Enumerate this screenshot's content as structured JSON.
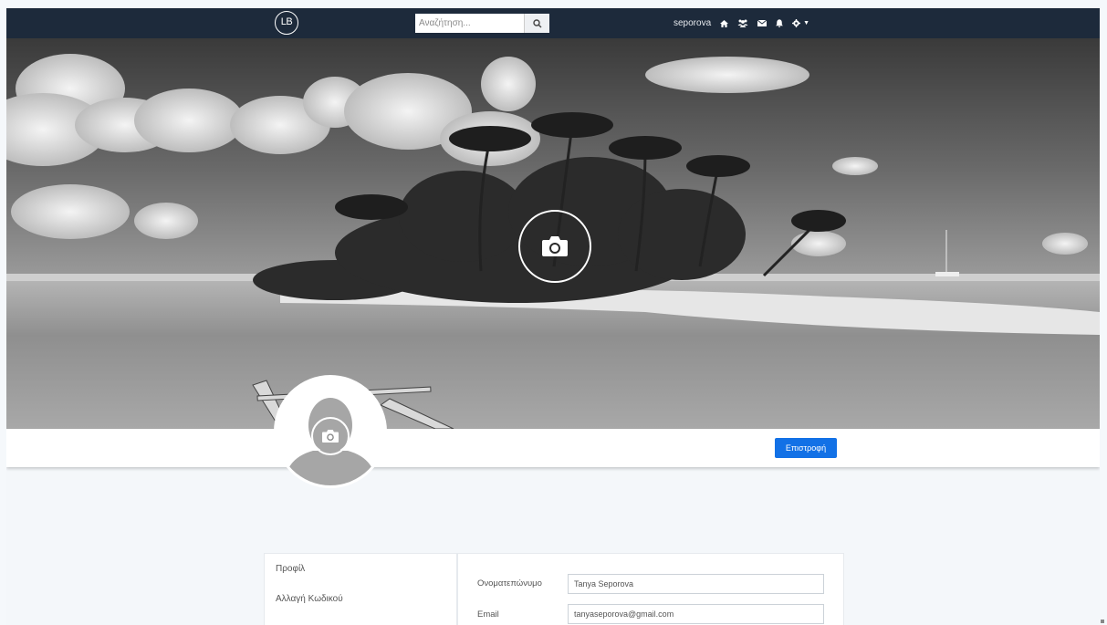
{
  "navbar": {
    "logo_text": "LB",
    "search_placeholder": "Αναζήτηση...",
    "username": "seporova",
    "icons": [
      "home-icon",
      "users-icon",
      "envelope-icon",
      "bell-icon",
      "gear-icon"
    ]
  },
  "profile": {
    "back_button": "Επιστροφή"
  },
  "sidebar": {
    "items": [
      {
        "label": "Προφίλ"
      },
      {
        "label": "Αλλαγή Κωδικού"
      }
    ]
  },
  "form": {
    "fullname_label": "Ονοματεπώνυμο",
    "fullname_value": "Tanya Seporova",
    "email_label": "Email",
    "email_value": "tanyaseporova@gmail.com"
  },
  "colors": {
    "navbar": "#1d2a3b",
    "primary_button": "#1271e6",
    "page_background": "#f4f7fa"
  }
}
